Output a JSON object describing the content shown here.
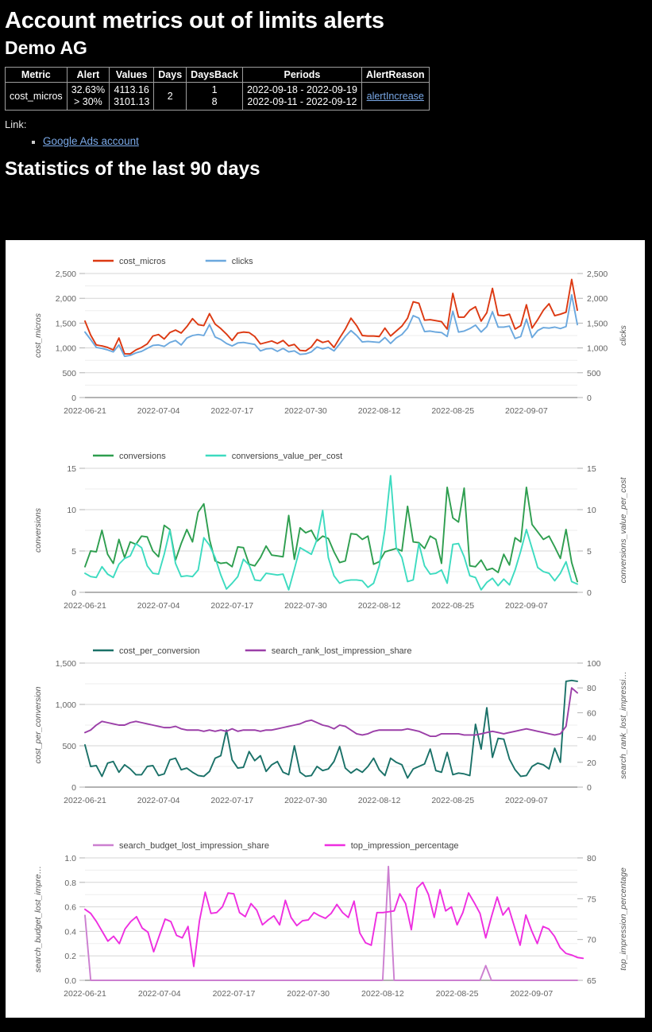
{
  "header": {
    "title": "Account metrics out of limits alerts",
    "subtitle": "Demo AG"
  },
  "alert_table": {
    "columns": [
      "Metric",
      "Alert",
      "Values",
      "Days",
      "DaysBack",
      "Periods",
      "AlertReason"
    ],
    "rows": [
      {
        "metric": "cost_micros",
        "alert_line1": "32.63%",
        "alert_line2": "> 30%",
        "values_line1": "4113.16",
        "values_line2": "3101.13",
        "days": "2",
        "daysback_line1": "1",
        "daysback_line2": "8",
        "periods_line1": "2022-09-18 - 2022-09-19",
        "periods_line2": "2022-09-11 - 2022-09-12",
        "alert_reason": "alertIncrease"
      }
    ]
  },
  "links_section": {
    "label": "Link:",
    "items": [
      {
        "text": "Google Ads account"
      }
    ]
  },
  "stats_section": {
    "heading": "Statistics of the last 90 days"
  },
  "chart_data": [
    {
      "type": "line",
      "title": "",
      "xlabel": "",
      "ylabel": "cost_micros",
      "y2label": "clicks",
      "grid": true,
      "legend_position": "top",
      "ylim": [
        0,
        2500
      ],
      "y2lim": [
        0,
        2500
      ],
      "yticks": [
        0,
        500,
        1000,
        1500,
        2000,
        2500
      ],
      "ytick_labels": [
        "0",
        "500",
        "1,000",
        "1,500",
        "2,000",
        "2,500"
      ],
      "y2ticks": [
        0,
        500,
        1000,
        1500,
        2000,
        2500
      ],
      "y2tick_labels": [
        "0",
        "500",
        "1,000",
        "1,500",
        "2,000",
        "2,500"
      ],
      "xtick_labels": [
        "2022-06-21",
        "2022-07-04",
        "2022-07-17",
        "2022-07-30",
        "2022-08-12",
        "2022-08-25",
        "2022-09-07"
      ],
      "xtick_indices": [
        0,
        13,
        26,
        39,
        52,
        65,
        78
      ],
      "series": [
        {
          "name": "cost_micros",
          "color": "#dc3912",
          "axis": "left",
          "values": [
            1540,
            1260,
            1060,
            1040,
            1010,
            960,
            1200,
            880,
            880,
            960,
            1010,
            1080,
            1240,
            1270,
            1180,
            1310,
            1360,
            1300,
            1430,
            1590,
            1470,
            1450,
            1690,
            1480,
            1390,
            1280,
            1150,
            1300,
            1320,
            1310,
            1230,
            1080,
            1110,
            1140,
            1090,
            1150,
            1040,
            1070,
            950,
            940,
            1020,
            1170,
            1110,
            1140,
            1010,
            1200,
            1380,
            1600,
            1450,
            1250,
            1240,
            1240,
            1230,
            1400,
            1240,
            1340,
            1440,
            1600,
            1930,
            1900,
            1560,
            1570,
            1550,
            1530,
            1380,
            2100,
            1620,
            1620,
            1760,
            1830,
            1540,
            1710,
            2200,
            1660,
            1650,
            1680,
            1380,
            1450,
            1870,
            1400,
            1570,
            1760,
            1890,
            1650,
            1680,
            1720,
            2380,
            1760
          ]
        },
        {
          "name": "clicks",
          "color": "#6ba8de",
          "axis": "right",
          "values": [
            1320,
            1170,
            1010,
            990,
            960,
            920,
            1060,
            830,
            850,
            900,
            930,
            990,
            1050,
            1060,
            1030,
            1110,
            1150,
            1060,
            1200,
            1250,
            1270,
            1250,
            1470,
            1220,
            1170,
            1090,
            1040,
            1100,
            1110,
            1090,
            1070,
            940,
            980,
            990,
            930,
            990,
            920,
            940,
            870,
            880,
            920,
            1020,
            980,
            1010,
            940,
            1080,
            1230,
            1350,
            1250,
            1120,
            1130,
            1120,
            1110,
            1210,
            1090,
            1200,
            1270,
            1400,
            1650,
            1600,
            1330,
            1340,
            1320,
            1310,
            1230,
            1740,
            1320,
            1340,
            1390,
            1460,
            1320,
            1430,
            1730,
            1420,
            1420,
            1440,
            1190,
            1230,
            1580,
            1210,
            1350,
            1410,
            1400,
            1420,
            1390,
            1430,
            2070,
            1470
          ]
        }
      ]
    },
    {
      "type": "line",
      "title": "",
      "xlabel": "",
      "ylabel": "conversions",
      "y2label": "conversions_value_per_cost",
      "grid": true,
      "legend_position": "top",
      "ylim": [
        0,
        15
      ],
      "y2lim": [
        0,
        15
      ],
      "yticks": [
        0,
        5,
        10,
        15
      ],
      "ytick_labels": [
        "0",
        "5",
        "10",
        "15"
      ],
      "y2ticks": [
        0,
        5,
        10,
        15
      ],
      "y2tick_labels": [
        "0",
        "5",
        "10",
        "15"
      ],
      "xtick_labels": [
        "2022-06-21",
        "2022-07-04",
        "2022-07-17",
        "2022-07-30",
        "2022-08-12",
        "2022-08-25",
        "2022-09-07"
      ],
      "xtick_indices": [
        0,
        13,
        26,
        39,
        52,
        65,
        78
      ],
      "series": [
        {
          "name": "conversions",
          "color": "#2e9e4f",
          "axis": "left",
          "values": [
            3.1,
            5.0,
            4.9,
            7.5,
            4.6,
            3.5,
            6.4,
            4.2,
            6.1,
            5.8,
            6.8,
            6.7,
            5.0,
            4.3,
            8.1,
            7.6,
            3.9,
            5.9,
            7.6,
            6.1,
            9.7,
            10.7,
            6.4,
            3.8,
            3.5,
            3.6,
            3.1,
            5.5,
            5.4,
            3.4,
            3.2,
            4.2,
            5.6,
            4.5,
            4.4,
            4.3,
            9.3,
            4.0,
            7.8,
            7.2,
            7.5,
            6.2,
            6.8,
            6.5,
            4.9,
            3.6,
            3.8,
            7.1,
            7.0,
            6.4,
            6.8,
            3.4,
            3.7,
            4.9,
            5.1,
            5.3,
            5.0,
            10.4,
            6.1,
            6.0,
            5.3,
            6.8,
            6.4,
            3.5,
            12.7,
            9.0,
            8.5,
            12.6,
            3.2,
            3.1,
            3.9,
            2.7,
            2.9,
            2.4,
            4.6,
            3.3,
            6.6,
            6.1,
            12.7,
            8.2,
            7.3,
            6.4,
            6.8,
            5.5,
            4.1,
            7.6,
            3.6,
            1.3
          ]
        },
        {
          "name": "conversions_value_per_cost",
          "color": "#3ddbc0",
          "axis": "right",
          "values": [
            2.3,
            1.9,
            1.8,
            3.1,
            2.2,
            1.8,
            3.4,
            4.1,
            4.4,
            5.9,
            5.4,
            3.2,
            2.3,
            2.2,
            4.6,
            7.5,
            3.5,
            1.9,
            2.0,
            1.9,
            2.7,
            6.6,
            5.7,
            4.2,
            2.1,
            0.4,
            1.1,
            1.9,
            4.0,
            3.3,
            1.5,
            1.4,
            2.3,
            2.2,
            2.1,
            2.2,
            0.3,
            2.8,
            5.4,
            5.0,
            4.6,
            6.4,
            9.9,
            4.2,
            2.0,
            1.1,
            1.4,
            1.5,
            1.5,
            1.4,
            0.6,
            1.1,
            3.2,
            7.6,
            14.1,
            5.4,
            4.2,
            1.3,
            1.5,
            5.9,
            3.2,
            2.2,
            2.3,
            2.7,
            1.1,
            5.8,
            5.9,
            4.3,
            2.0,
            1.8,
            0.3,
            1.2,
            1.7,
            0.8,
            1.6,
            0.9,
            2.7,
            5.0,
            7.6,
            5.3,
            3.0,
            2.5,
            2.3,
            1.4,
            2.3,
            3.7,
            1.3,
            1.0
          ]
        }
      ]
    },
    {
      "type": "line",
      "title": "",
      "xlabel": "",
      "ylabel": "cost_per_conversion",
      "y2label": "search_rank_lost_impressi…",
      "grid": true,
      "legend_position": "top",
      "ylim": [
        0,
        1500
      ],
      "y2lim": [
        0,
        100
      ],
      "yticks": [
        0,
        500,
        1000,
        1500
      ],
      "ytick_labels": [
        "0",
        "500",
        "1,000",
        "1,500"
      ],
      "y2ticks": [
        0,
        20,
        40,
        60,
        80,
        100
      ],
      "y2tick_labels": [
        "0",
        "20",
        "40",
        "60",
        "80",
        "100"
      ],
      "xtick_labels": [
        "2022-06-21",
        "2022-07-04",
        "2022-07-17",
        "2022-07-30",
        "2022-08-12",
        "2022-08-25",
        "2022-09-07"
      ],
      "xtick_indices": [
        0,
        13,
        26,
        39,
        52,
        65,
        78
      ],
      "series": [
        {
          "name": "cost_per_conversion",
          "color": "#1a7168",
          "axis": "left",
          "values": [
            510,
            250,
            260,
            130,
            290,
            310,
            180,
            270,
            220,
            150,
            150,
            250,
            260,
            140,
            160,
            330,
            350,
            210,
            230,
            180,
            140,
            130,
            190,
            350,
            380,
            690,
            330,
            230,
            240,
            430,
            320,
            380,
            190,
            270,
            310,
            180,
            150,
            500,
            180,
            130,
            140,
            250,
            200,
            220,
            310,
            490,
            230,
            170,
            220,
            180,
            250,
            350,
            210,
            140,
            350,
            300,
            270,
            110,
            220,
            250,
            280,
            460,
            200,
            180,
            420,
            150,
            170,
            160,
            140,
            760,
            460,
            960,
            360,
            590,
            580,
            340,
            210,
            130,
            140,
            250,
            290,
            270,
            220,
            470,
            300,
            1280,
            1290,
            1280
          ]
        },
        {
          "name": "search_rank_lost_impression_share",
          "color": "#9b3fa8",
          "axis": "right",
          "values": [
            44,
            46,
            50,
            53,
            52,
            51,
            50,
            50,
            52,
            53,
            52,
            51,
            50,
            49,
            48,
            48,
            49,
            47,
            46,
            46,
            46,
            45,
            46,
            45,
            46,
            45,
            47,
            45,
            46,
            46,
            46,
            45,
            46,
            46,
            47,
            48,
            49,
            50,
            51,
            53,
            54,
            52,
            50,
            49,
            47,
            50,
            49,
            46,
            43,
            42,
            43,
            45,
            46,
            46,
            46,
            46,
            46,
            47,
            46,
            45,
            43,
            41,
            41,
            43,
            43,
            43,
            43,
            42,
            42,
            42,
            43,
            44,
            45,
            44,
            43,
            44,
            45,
            46,
            47,
            46,
            45,
            44,
            43,
            42,
            43,
            49,
            80,
            76
          ]
        }
      ]
    },
    {
      "type": "line",
      "title": "",
      "xlabel": "",
      "ylabel": "search_budget_lost_impre…",
      "y2label": "top_impression_percentage",
      "grid": true,
      "legend_position": "top",
      "ylim": [
        0,
        1.0
      ],
      "y2lim": [
        65,
        80
      ],
      "yticks": [
        0,
        0.2,
        0.4,
        0.6,
        0.8,
        1.0
      ],
      "ytick_labels": [
        "0.0",
        "0.2",
        "0.4",
        "0.6",
        "0.8",
        "1.0"
      ],
      "y2ticks": [
        65,
        70,
        75,
        80
      ],
      "y2tick_labels": [
        "65",
        "70",
        "75",
        "80"
      ],
      "xtick_labels": [
        "2022-06-21",
        "2022-07-04",
        "2022-07-17",
        "2022-07-30",
        "2022-08-12",
        "2022-08-25",
        "2022-09-07"
      ],
      "xtick_indices": [
        0,
        13,
        26,
        39,
        52,
        65,
        78
      ],
      "series": [
        {
          "name": "search_budget_lost_impression_share",
          "color": "#cc7fd0",
          "axis": "left",
          "values": [
            0.53,
            0,
            0,
            0,
            0,
            0,
            0,
            0,
            0,
            0,
            0,
            0,
            0,
            0,
            0,
            0,
            0,
            0,
            0,
            0,
            0,
            0,
            0,
            0,
            0,
            0,
            0,
            0,
            0,
            0,
            0,
            0,
            0,
            0,
            0,
            0,
            0,
            0,
            0,
            0,
            0,
            0,
            0,
            0,
            0,
            0,
            0,
            0,
            0,
            0,
            0,
            0,
            0,
            0.93,
            0,
            0,
            0,
            0,
            0,
            0,
            0,
            0,
            0,
            0,
            0,
            0,
            0,
            0,
            0,
            0,
            0.12,
            0,
            0,
            0,
            0,
            0,
            0,
            0,
            0,
            0,
            0,
            0,
            0,
            0,
            0,
            0,
            0
          ]
        },
        {
          "name": "top_impression_percentage",
          "color": "#ee2ee0",
          "axis": "right",
          "values": [
            73.7,
            73.2,
            72.2,
            71.0,
            69.8,
            70.4,
            69.5,
            71.3,
            72.2,
            72.8,
            71.4,
            70.9,
            68.5,
            70.5,
            72.5,
            72.2,
            70.5,
            70.2,
            71.6,
            66.7,
            72.3,
            75.8,
            73.2,
            73.3,
            74.0,
            75.7,
            75.6,
            73.3,
            72.8,
            74.4,
            73.6,
            71.8,
            72.4,
            72.9,
            71.8,
            74.8,
            72.7,
            71.7,
            72.3,
            72.4,
            73.3,
            72.9,
            72.6,
            73.2,
            74.3,
            73.3,
            72.7,
            74.7,
            70.8,
            69.6,
            69.3,
            73.3,
            73.3,
            73.4,
            73.5,
            75.6,
            74.4,
            71.2,
            76.3,
            77.0,
            75.5,
            72.7,
            76.1,
            73.5,
            74.0,
            71.8,
            73.3,
            75.7,
            74.5,
            73.2,
            70.2,
            72.8,
            75.2,
            73.0,
            73.9,
            71.6,
            69.3,
            73.0,
            71.1,
            69.5,
            71.6,
            71.3,
            70.4,
            69.0,
            68.3,
            68.1,
            67.8,
            67.7
          ]
        }
      ]
    }
  ]
}
